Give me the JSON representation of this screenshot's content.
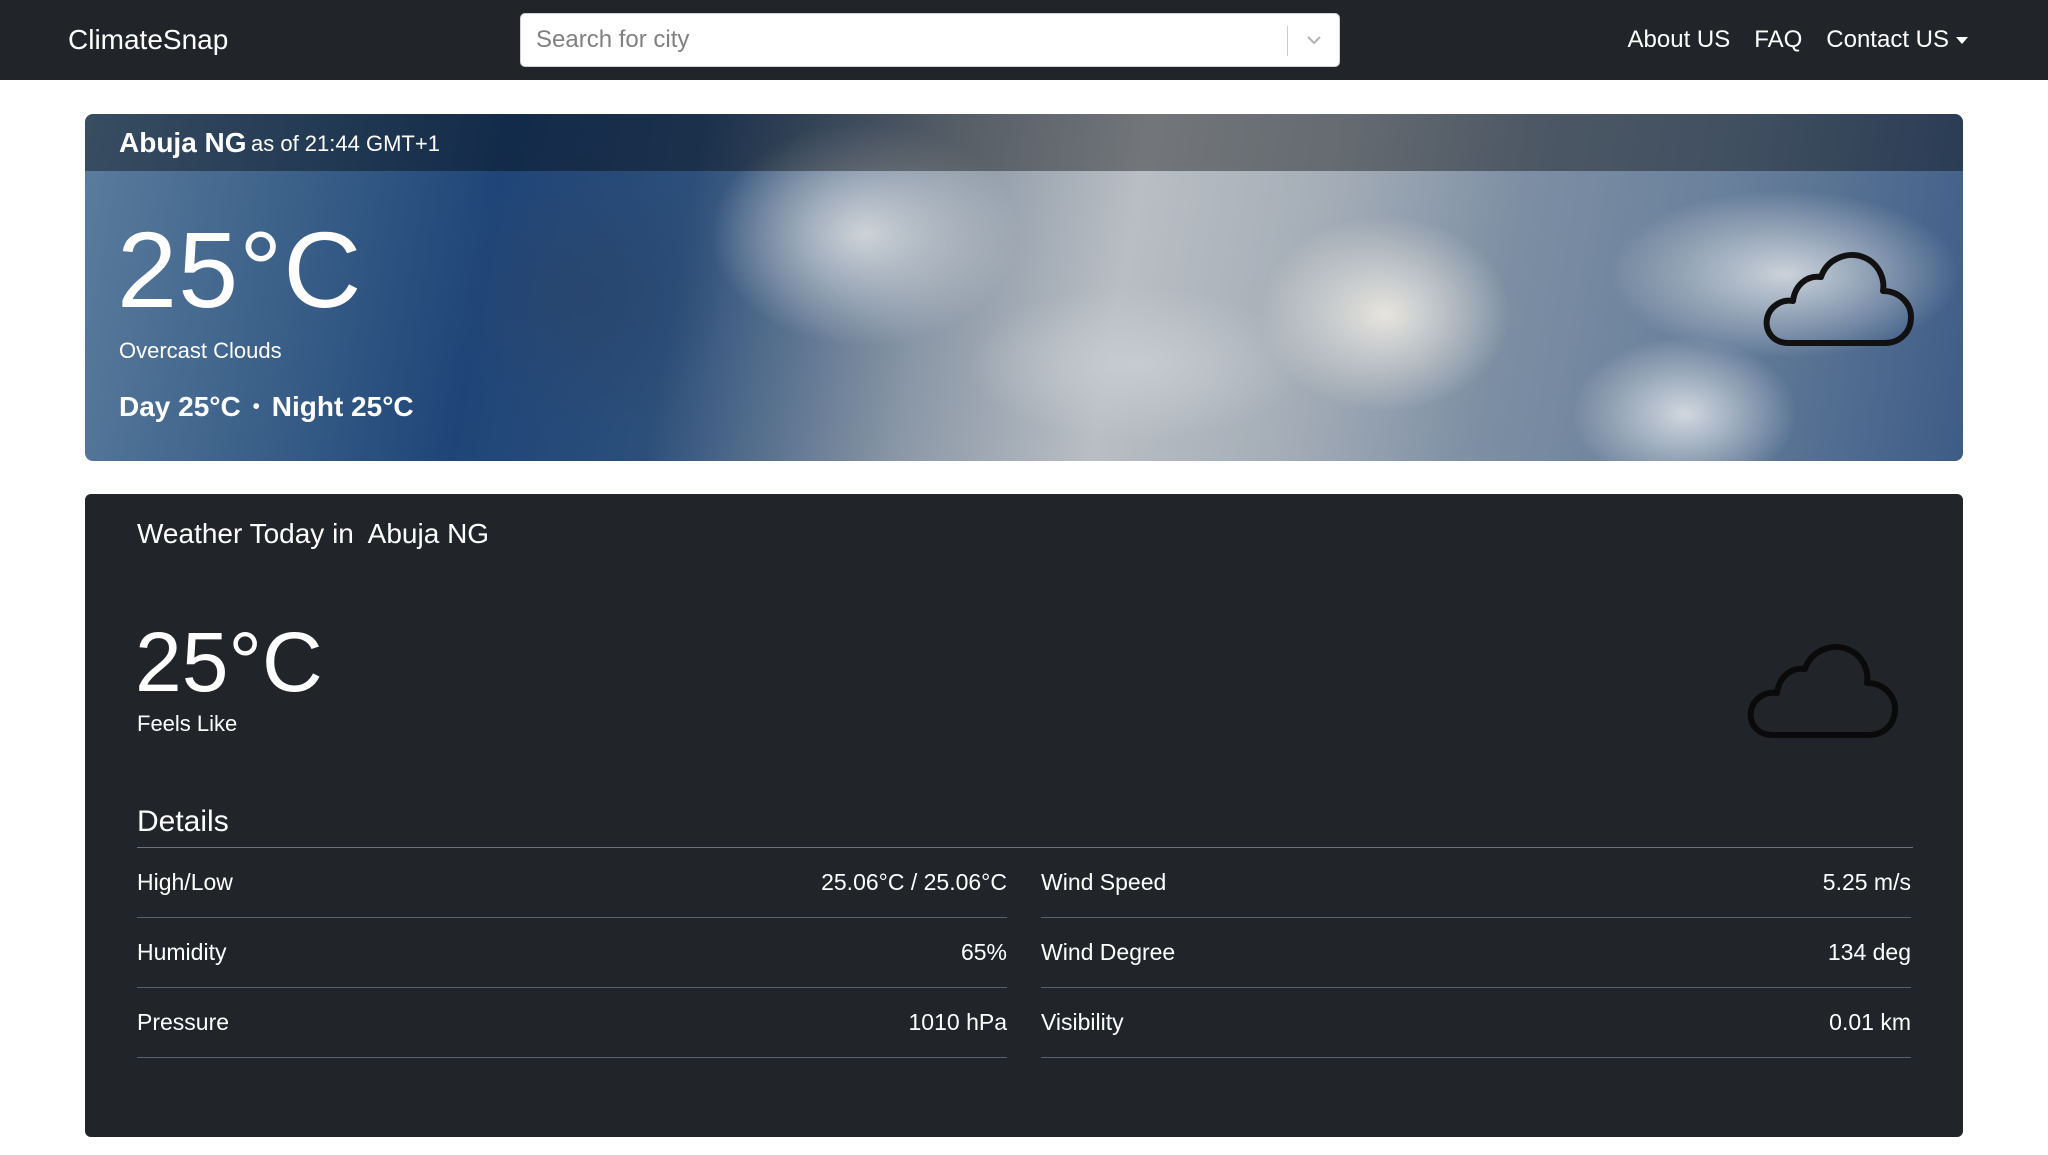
{
  "navbar": {
    "brand": "ClimateSnap",
    "search_placeholder": "Search for city",
    "links": [
      "About US",
      "FAQ",
      "Contact US"
    ]
  },
  "hero": {
    "city": "Abuja NG",
    "as_of": "as of 21:44 GMT+1",
    "temperature": "25°C",
    "description": "Overcast Clouds",
    "day": "Day 25°C",
    "separator": "•",
    "night": "Night 25°C",
    "icon": "cloud-icon"
  },
  "today": {
    "title_prefix": "Weather Today in",
    "city": "Abuja NG",
    "feels_like_temp": "25°C",
    "feels_like_label": "Feels Like",
    "icon": "cloud-icon",
    "details_heading": "Details",
    "left_details": [
      {
        "label": "High/Low",
        "value": "25.06°C / 25.06°C"
      },
      {
        "label": "Humidity",
        "value": "65%"
      },
      {
        "label": "Pressure",
        "value": "1010 hPa"
      }
    ],
    "right_details": [
      {
        "label": "Wind Speed",
        "value": "5.25 m/s"
      },
      {
        "label": "Wind Degree",
        "value": "134 deg"
      },
      {
        "label": "Visibility",
        "value": "0.01 km"
      }
    ]
  },
  "colors": {
    "navbar_bg": "#212529",
    "card_bg": "#212529",
    "text_light": "#ffffff"
  }
}
